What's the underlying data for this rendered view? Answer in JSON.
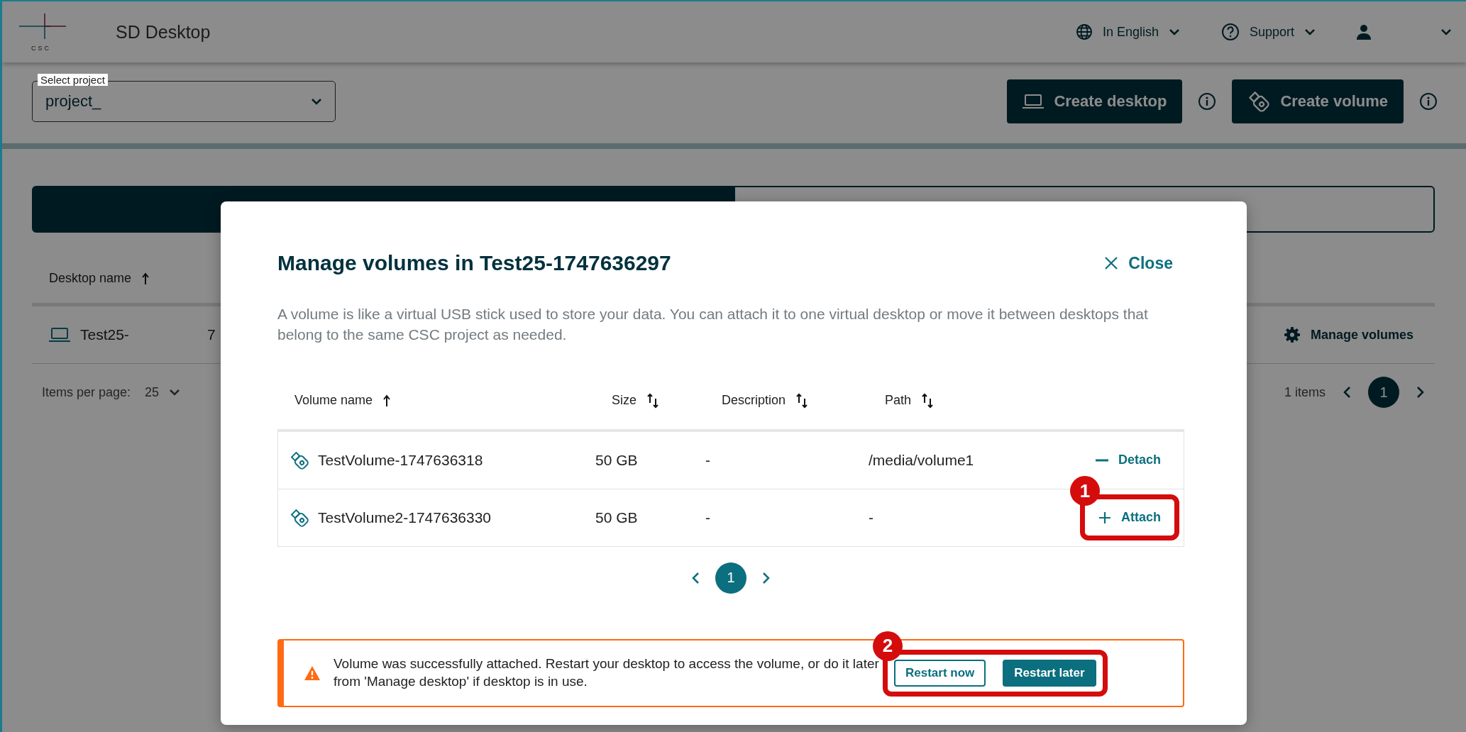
{
  "header": {
    "logo_text": "CSC",
    "app_title": "SD Desktop",
    "language": "In English",
    "support": "Support"
  },
  "toolbar": {
    "project_select": {
      "label": "Select project",
      "value": "project_"
    },
    "buttons": [
      {
        "label": "Create desktop",
        "kind": "desktop"
      },
      {
        "label": "Create volume",
        "kind": "volume"
      }
    ]
  },
  "tabs": [
    {
      "selected": true
    },
    {
      "selected": false
    }
  ],
  "desktops_table": {
    "columns": [
      "Desktop name"
    ],
    "rows": [
      {
        "name": "Test25-",
        "column_2": "7",
        "action": "Manage volumes"
      }
    ],
    "pagination": {
      "items_per_page_label": "Items per page:",
      "items_per_page": "25",
      "items_count": "1 items",
      "pages": [
        {
          "label": "1",
          "selected": true
        }
      ]
    }
  },
  "dialog": {
    "title": "Manage volumes in Test25-1747636297",
    "close": "Close",
    "description": "A volume is like a virtual USB stick used to store your data. You can attach it to one virtual desktop or move it between desktops that belong to the same CSC project as needed.",
    "columns": [
      {
        "label": "Volume name",
        "sorted": true
      },
      {
        "label": "Size",
        "sorted": false
      },
      {
        "label": "Description",
        "sorted": false
      },
      {
        "label": "Path",
        "sorted": false
      }
    ],
    "rows": [
      {
        "name": "TestVolume-1747636318",
        "size": "50 GB",
        "description": "-",
        "path": "/media/volume1",
        "action": {
          "kind": "detach",
          "label": "Detach"
        }
      },
      {
        "name": "TestVolume2-1747636330",
        "size": "50 GB",
        "description": "-",
        "path": "-",
        "action": {
          "kind": "attach",
          "label": "Attach"
        },
        "annotation": "1"
      }
    ],
    "pages": [
      {
        "label": "1",
        "selected": true
      }
    ],
    "alert": {
      "text": "Volume was successfully attached. Restart your desktop to access the volume, or do it later from 'Manage desktop' if desktop is in use.",
      "annotation": "2",
      "buttons": [
        {
          "label": "Restart now",
          "kind": "secondary"
        },
        {
          "label": "Restart later",
          "kind": "primary"
        }
      ]
    }
  }
}
